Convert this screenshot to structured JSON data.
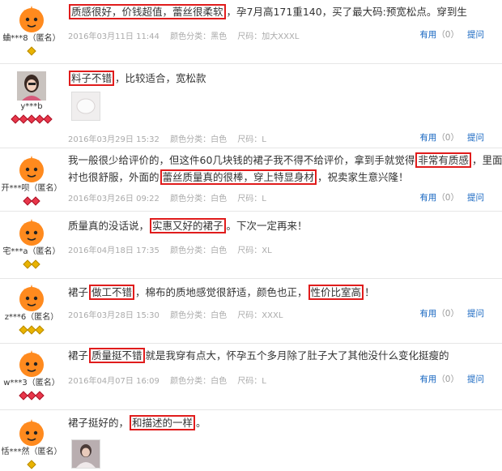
{
  "reviews": [
    {
      "user": "蛐***8（匿名）",
      "avatar": "default-avatar",
      "level_gems": 1,
      "level_color": "yellow",
      "text_parts": [
        {
          "t": "质感很好，价钱超值，蕾丝很柔软",
          "hl": true
        },
        {
          "t": "，孕7月高171重140，买了最大码:预宽松点。穿到生",
          "hl": false
        }
      ],
      "date": "2016年03月11日 11:44",
      "color": "颜色分类：黑色",
      "size": "尺码：加大XXXL",
      "useful": "有用",
      "useful_count": "（0）",
      "ask": "提问"
    },
    {
      "user": "y***b",
      "avatar": "photo-avatar",
      "level_gems": 5,
      "level_color": "red",
      "text_parts": [
        {
          "t": "料子不错",
          "hl": true
        },
        {
          "t": "，比较适合，宽松款",
          "hl": false
        }
      ],
      "date": "2016年03月29日 15:32",
      "color": "颜色分类：白色",
      "size": "尺码：L",
      "useful": "有用",
      "useful_count": "（0）",
      "ask": "提问"
    },
    {
      "user": "开***呗（匿名）",
      "avatar": "default-avatar",
      "level_gems": 2,
      "level_color": "red",
      "line1_parts": [
        {
          "t": "我一般很少给评价的，但这件60几块钱的裙子我不得不给评价，拿到手就觉得",
          "hl": false
        },
        {
          "t": "非常有质感",
          "hl": true
        },
        {
          "t": "，里面的内",
          "hl": false
        }
      ],
      "line2_parts": [
        {
          "t": "衬也很舒服，外面的",
          "hl": false
        },
        {
          "t": "蕾丝质量真的很棒，穿上特显身材",
          "hl": true
        },
        {
          "t": "，祝卖家生意兴隆！",
          "hl": false
        }
      ],
      "date": "2016年03月26日 09:22",
      "color": "颜色分类：白色",
      "size": "尺码：L",
      "useful": "有用",
      "useful_count": "（0）",
      "ask": "提问"
    },
    {
      "user": "宅***a（匿名）",
      "avatar": "default-avatar",
      "level_gems": 2,
      "level_color": "yellow",
      "text_parts": [
        {
          "t": "质量真的没话说，",
          "hl": false
        },
        {
          "t": "实惠又好的裙子",
          "hl": true
        },
        {
          "t": "。下次一定再来！",
          "hl": false
        }
      ],
      "date": "2016年04月18日 17:35",
      "color": "颜色分类：白色",
      "size": "尺码：XL",
      "useful": "有用",
      "useful_count": "（0）",
      "ask": "提问"
    },
    {
      "user": "z***6（匿名）",
      "avatar": "default-avatar",
      "level_gems": 3,
      "level_color": "yellow",
      "text_parts": [
        {
          "t": "裙子",
          "hl": false
        },
        {
          "t": "做工不错",
          "hl": true
        },
        {
          "t": "，棉布的质地感觉很舒适，颜色也正，",
          "hl": false
        },
        {
          "t": "性价比室高",
          "hl": true
        },
        {
          "t": "！",
          "hl": false
        }
      ],
      "date": "2016年03月28日 15:30",
      "color": "颜色分类：白色",
      "size": "尺码：XXXL",
      "useful": "有用",
      "useful_count": "（0）",
      "ask": "提问"
    },
    {
      "user": "w***3（匿名）",
      "avatar": "default-avatar",
      "level_gems": 3,
      "level_color": "red",
      "text_parts": [
        {
          "t": "裙子",
          "hl": false
        },
        {
          "t": "质量挺不错",
          "hl": true
        },
        {
          "t": "就是我穿有点大，怀孕五个多月除了肚子大了其他没什么变化挺瘦的",
          "hl": false
        }
      ],
      "date": "2016年04月07日 16:09",
      "color": "颜色分类：白色",
      "size": "尺码：L",
      "useful": "有用",
      "useful_count": "（0）",
      "ask": "提问"
    },
    {
      "user": "恬***然（匿名）",
      "avatar": "default-avatar",
      "level_gems": 1,
      "level_color": "yellow",
      "text_parts": [
        {
          "t": "裙子挺好的，",
          "hl": false
        },
        {
          "t": "和描述的一样",
          "hl": true
        },
        {
          "t": "。",
          "hl": false
        }
      ]
    }
  ]
}
